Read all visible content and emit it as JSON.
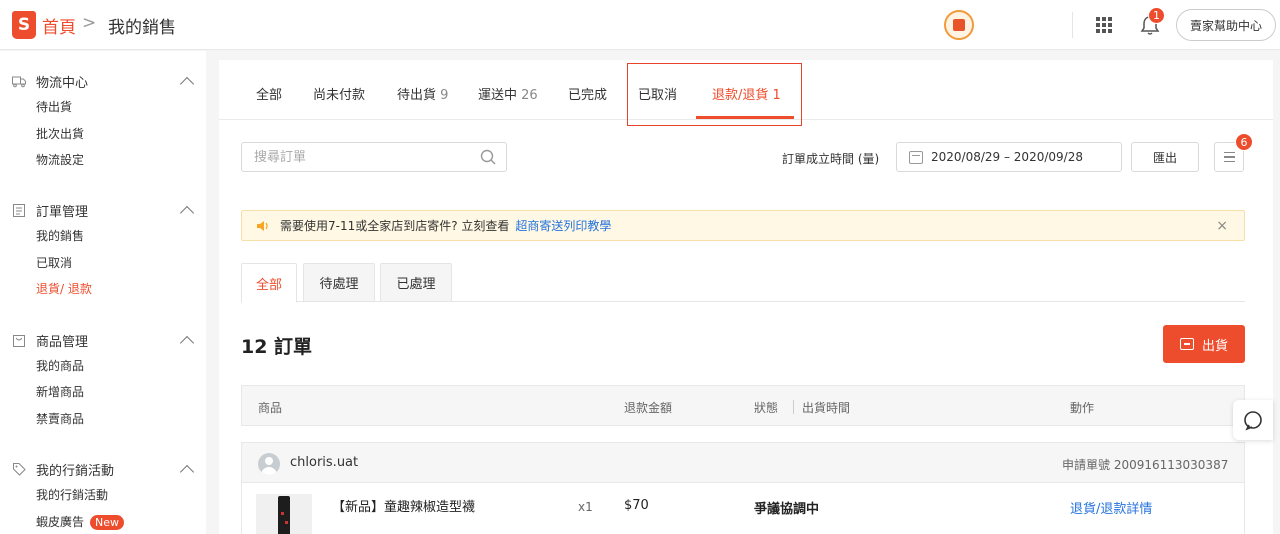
{
  "header": {
    "logo_letter": "S",
    "breadcrumb_home": "首頁",
    "breadcrumb_sep": ">",
    "breadcrumb_current": "我的銷售",
    "notification_count": "1",
    "help_label": "賣家幫助中心"
  },
  "sidebar": {
    "sections": [
      {
        "title": "物流中心",
        "icon": "truck-icon",
        "items": [
          "待出貨",
          "批次出貨",
          "物流設定"
        ]
      },
      {
        "title": "訂單管理",
        "icon": "clipboard-icon",
        "items": [
          "我的銷售",
          "已取消",
          "退貨/ 退款"
        ]
      },
      {
        "title": "商品管理",
        "icon": "bag-icon",
        "items": [
          "我的商品",
          "新增商品",
          "禁賣商品"
        ]
      },
      {
        "title": "我的行銷活動",
        "icon": "tag-icon",
        "items": [
          "我的行銷活動",
          "蝦皮廣告"
        ]
      }
    ],
    "active_item": "退貨/ 退款",
    "new_badge": "New"
  },
  "tabs": [
    {
      "label": "全部",
      "count": ""
    },
    {
      "label": "尚未付款",
      "count": ""
    },
    {
      "label": "待出貨",
      "count": "9"
    },
    {
      "label": "運送中",
      "count": "26"
    },
    {
      "label": "已完成",
      "count": ""
    },
    {
      "label": "已取消",
      "count": ""
    },
    {
      "label": "退款/退貨",
      "count": "1"
    }
  ],
  "active_tab": "退款/退貨",
  "search": {
    "placeholder": "搜尋訂單"
  },
  "date_filter": {
    "label": "訂單成立時間 (量)",
    "range": "2020/08/29 – 2020/09/28"
  },
  "export_label": "匯出",
  "list_badge": "6",
  "notice": {
    "text": "需要使用7-11或全家店到店寄件? 立刻查看",
    "link": "超商寄送列印教學",
    "close": "×"
  },
  "subtabs": [
    "全部",
    "待處理",
    "已處理"
  ],
  "order_count": "12 訂單",
  "ship_button": "出貨",
  "table_headers": {
    "product": "商品",
    "refund_amount": "退款金額",
    "status": "狀態",
    "ship_time": "出貨時間",
    "action": "動作"
  },
  "order": {
    "buyer": "chloris.uat",
    "request_label": "申請單號 200916113030387",
    "product_name": "【新品】童趣辣椒造型襪",
    "qty": "x1",
    "amount": "$70",
    "status": "爭議協調中",
    "action": "退貨/退款詳情"
  },
  "colors": {
    "brand": "#ee4d2d",
    "link": "#2673dd",
    "notice_bg": "#fff8e4"
  }
}
